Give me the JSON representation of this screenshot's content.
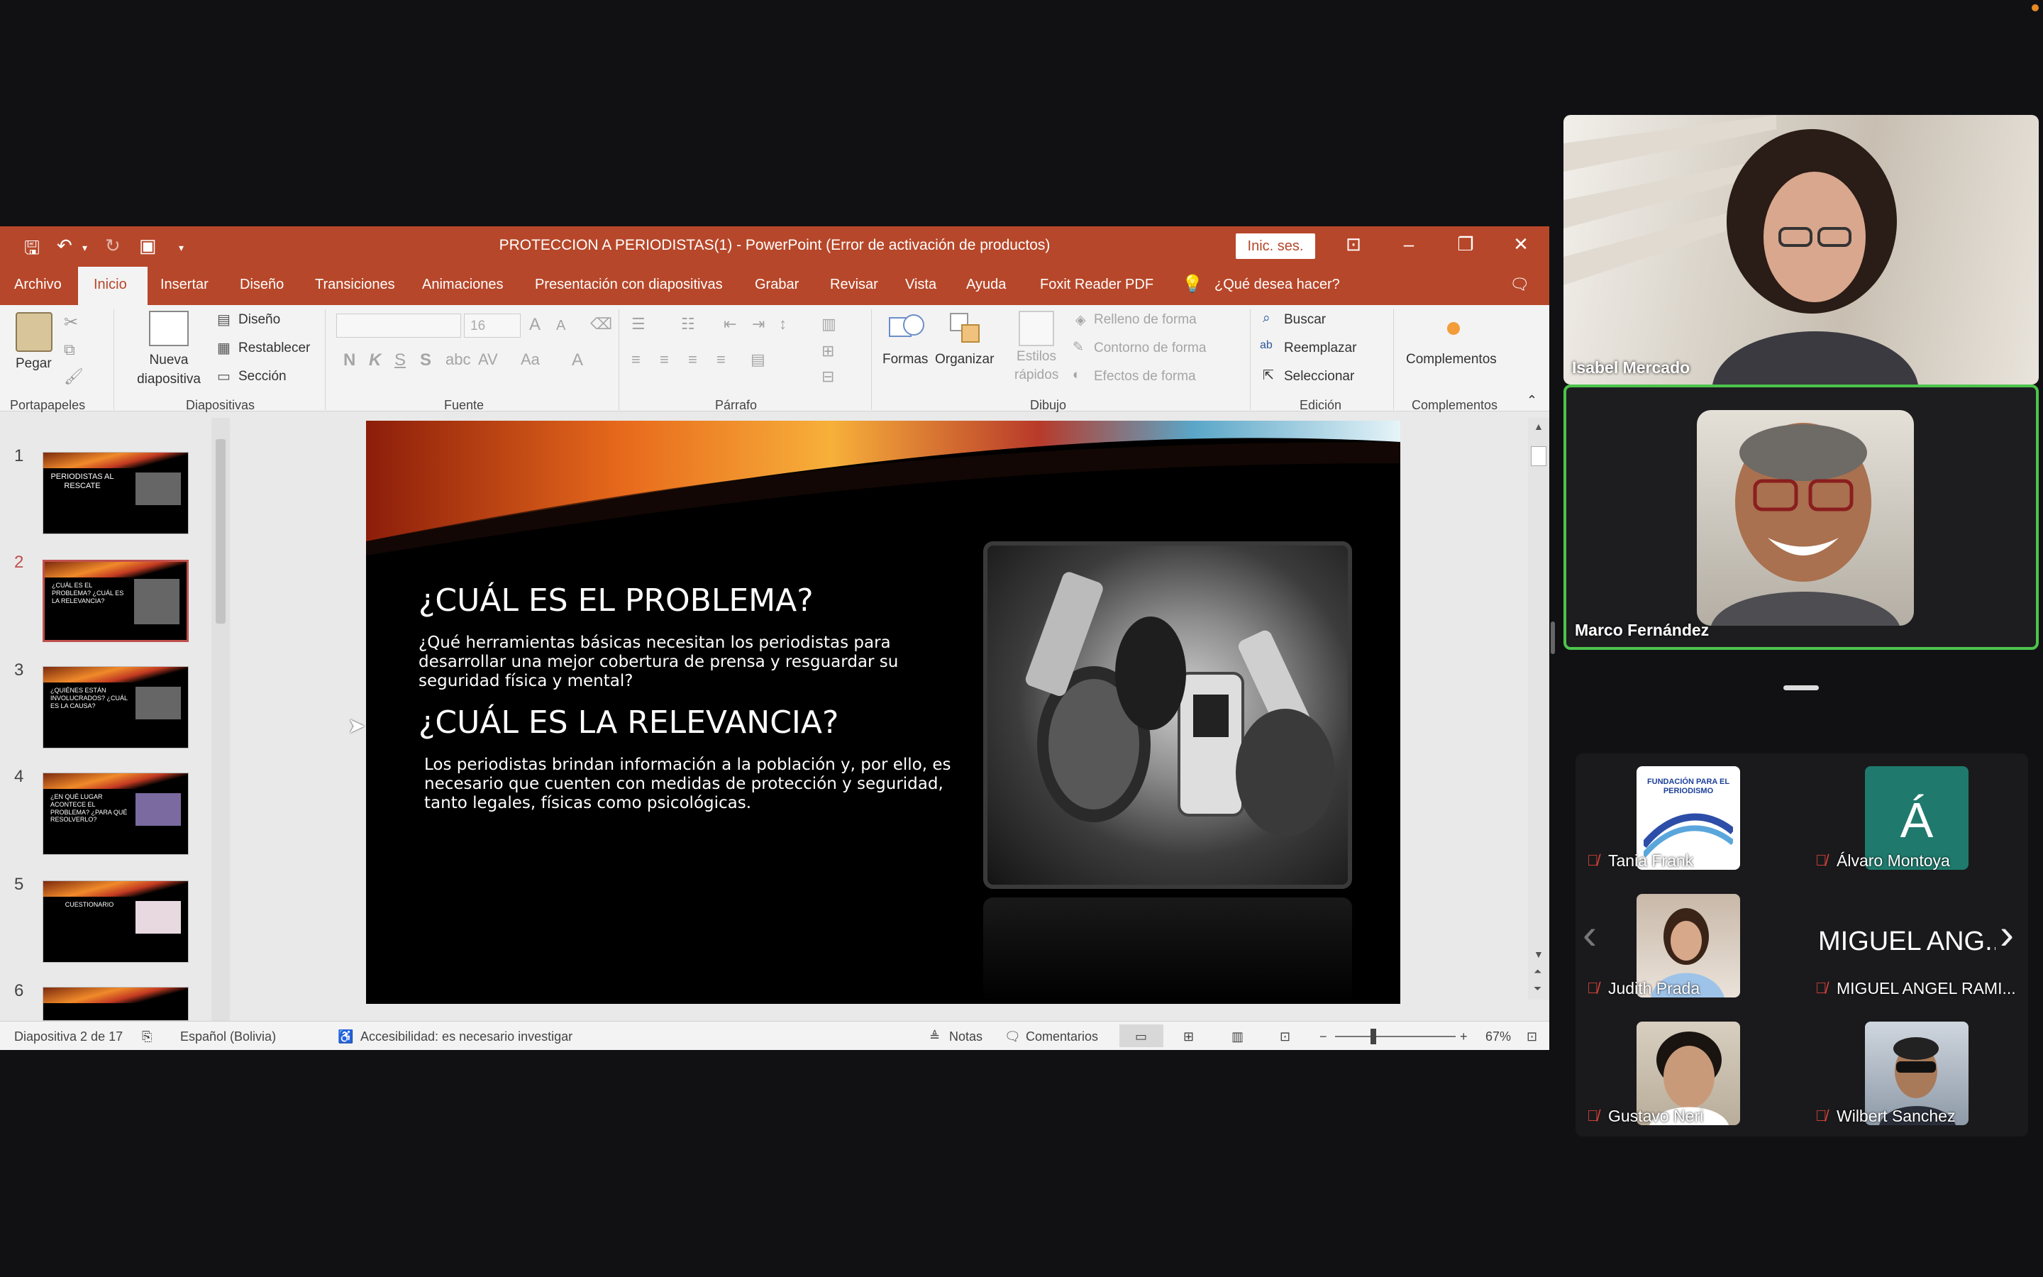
{
  "app": {
    "doc_title": "PROTECCION A PERIODISTAS(1)  -  PowerPoint (Error de activación de productos)",
    "signin": "Inic. ses."
  },
  "tabs": [
    "Archivo",
    "Inicio",
    "Insertar",
    "Diseño",
    "Transiciones",
    "Animaciones",
    "Presentación con diapositivas",
    "Grabar",
    "Revisar",
    "Vista",
    "Ayuda",
    "Foxit Reader PDF"
  ],
  "tell_me": "¿Qué desea hacer?",
  "ribbon": {
    "pegar": "Pegar",
    "nueva_diapositiva": "Nueva\ndiapositiva",
    "diseno": "Diseño",
    "restablecer": "Restablecer",
    "seccion": "Sección",
    "font_size": "16",
    "formas": "Formas",
    "organizar": "Organizar",
    "estilos_rapidos": "Estilos\nrápidos",
    "relleno": "Relleno de forma",
    "contorno": "Contorno de forma",
    "efectos": "Efectos de forma",
    "buscar": "Buscar",
    "reemplazar": "Reemplazar",
    "seleccionar": "Seleccionar",
    "complementos": "Complementos",
    "groups": {
      "portapapeles": "Portapapeles",
      "diapositivas": "Diapositivas",
      "fuente": "Fuente",
      "parrafo": "Párrafo",
      "dibujo": "Dibujo",
      "edicion": "Edición",
      "complementos": "Complementos"
    }
  },
  "thumbnails": [
    {
      "num": "1",
      "text": "PERIODISTAS AL RESCATE"
    },
    {
      "num": "2",
      "text": "¿CUÁL ES EL PROBLEMA? ¿CUÁL ES LA RELEVANCIA?"
    },
    {
      "num": "3",
      "text": "¿QUIÉNES ESTÁN INVOLUCRADOS? ¿CUÁL ES LA CAUSA?"
    },
    {
      "num": "4",
      "text": "¿EN QUÉ LUGAR ACONTECE EL PROBLEMA? ¿PARA QUÉ RESOLVERLO?"
    },
    {
      "num": "5",
      "text": "CUESTIONARIO"
    },
    {
      "num": "6",
      "text": ""
    }
  ],
  "slide": {
    "heading1": "¿CUÁL ES EL PROBLEMA?",
    "body1": "¿Qué herramientas básicas necesitan los periodistas para desarrollar una mejor cobertura de prensa y resguardar su seguridad física y mental?",
    "heading2": "¿CUÁL ES LA RELEVANCIA?",
    "body2": "Los periodistas brindan información a la población y, por ello, es necesario que cuenten con medidas de protección y seguridad, tanto legales, físicas como psicológicas."
  },
  "status": {
    "slide_of": "Diapositiva 2 de 17",
    "language": "Español (Bolivia)",
    "accessibility": "Accesibilidad: es necesario investigar",
    "notas": "Notas",
    "comentarios": "Comentarios",
    "zoom": "67%"
  },
  "participants": {
    "speaker1": "Isabel Mercado",
    "speaker2": "Marco Fernández",
    "gallery": [
      {
        "name": "Tania Frank",
        "logo_text": "FUNDACIÓN PARA EL PERIODISMO"
      },
      {
        "name": "Álvaro Montoya",
        "initial": "Á"
      },
      {
        "name": "Judith Prada"
      },
      {
        "name": "MIGUEL ANGEL RAMI...",
        "big_label": "MIGUEL ANG..."
      },
      {
        "name": "Gustavo Neri"
      },
      {
        "name": "Wilbert Sanchez"
      }
    ]
  },
  "colors": {
    "ppt_brand": "#b7472a",
    "active_speaker_border": "#4cc44c",
    "muted_mic": "#e0453a",
    "initial_tile": "#1f7a6d"
  }
}
